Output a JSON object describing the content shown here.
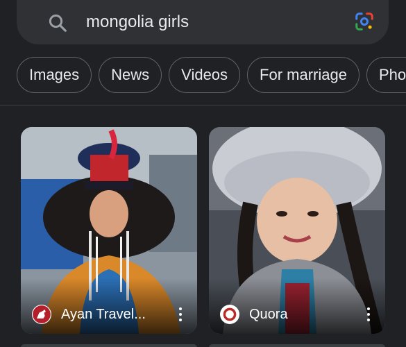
{
  "search": {
    "query": "mongolia girls"
  },
  "chips": [
    {
      "label": "Images"
    },
    {
      "label": "News"
    },
    {
      "label": "Videos"
    },
    {
      "label": "For marriage"
    },
    {
      "label": "Phot"
    }
  ],
  "results": [
    {
      "source": "Ayan Travel...",
      "icon": "horse-icon"
    },
    {
      "source": "Quora",
      "icon": "quora-icon"
    }
  ],
  "colors": {
    "background": "#202124",
    "searchbar": "#303134",
    "chip_border": "#5f6368",
    "text": "#e8eaed"
  }
}
